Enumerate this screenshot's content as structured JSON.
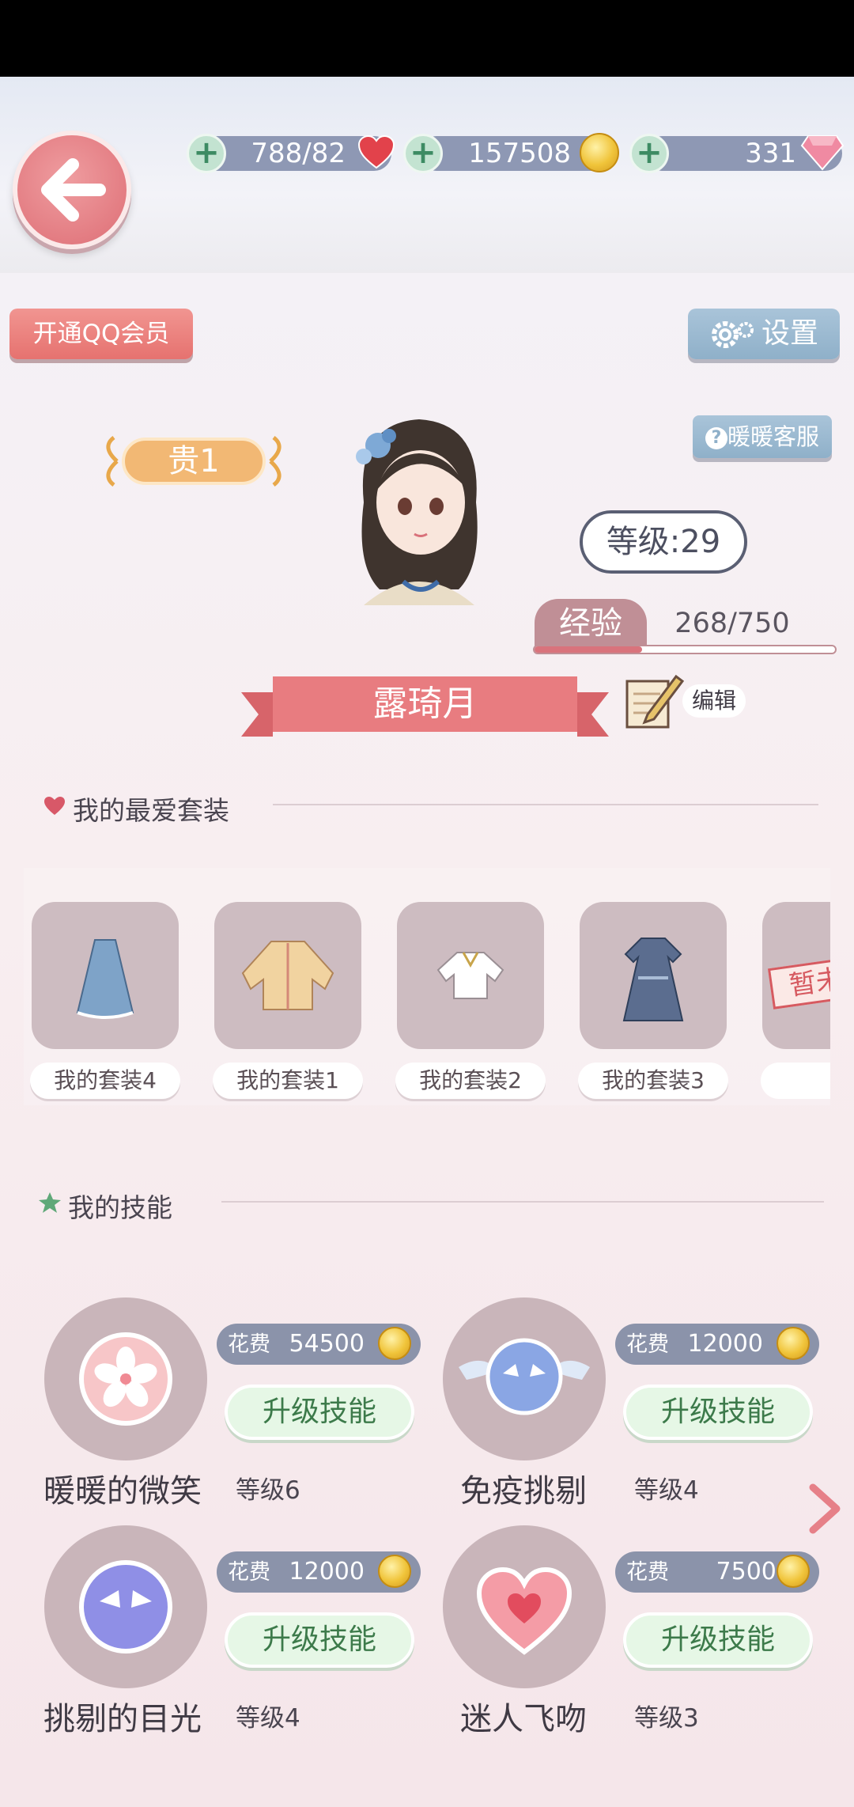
{
  "resources": {
    "stamina": "788/82",
    "gold": "157508",
    "diamonds": "331"
  },
  "buttons": {
    "qq_member": "开通QQ会员",
    "settings": "设置",
    "customer_service": "暖暖客服",
    "edit": "编辑"
  },
  "profile": {
    "vip_rank": "贵1",
    "level": "等级:29",
    "exp_label": "经验",
    "exp_value": "268/750",
    "exp_fraction": 0.357,
    "name": "露琦月"
  },
  "favorites": {
    "title": "我的最爱套装",
    "items": [
      {
        "label": "我的套装4"
      },
      {
        "label": "我的套装1"
      },
      {
        "label": "我的套装2"
      },
      {
        "label": "我的套装3"
      }
    ],
    "placeholder_stamp": "暂未"
  },
  "skills": {
    "title": "我的技能",
    "upgrade_label": "升级技能",
    "cost_label": "花费",
    "items": [
      {
        "name": "暖暖的微笑",
        "level": "等级6",
        "cost": "54500"
      },
      {
        "name": "免疫挑剔",
        "level": "等级4",
        "cost": "12000"
      },
      {
        "name": "挑剔的目光",
        "level": "等级4",
        "cost": "12000"
      },
      {
        "name": "迷人飞吻",
        "level": "等级3",
        "cost": "7500"
      }
    ]
  },
  "colors": {
    "accent_pink": "#e87c80",
    "bar_gray": "#8e98b4",
    "green_button": "#e6f7e6"
  }
}
